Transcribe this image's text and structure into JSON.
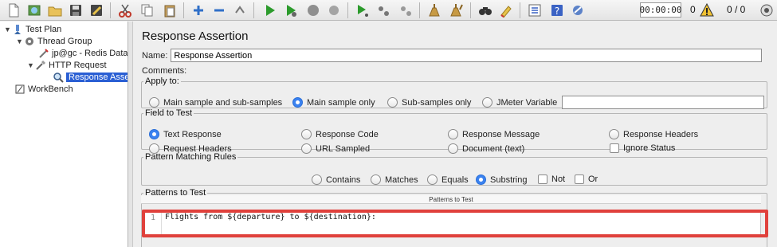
{
  "toolbar": {
    "buttons": [
      {
        "name": "new-icon"
      },
      {
        "name": "templates-icon"
      },
      {
        "name": "open-icon"
      },
      {
        "name": "save-icon"
      },
      {
        "name": "save-as-icon"
      },
      {
        "name": "cut-icon"
      },
      {
        "name": "copy-icon"
      },
      {
        "name": "paste-icon"
      },
      {
        "name": "expand-icon"
      },
      {
        "name": "collapse-icon"
      },
      {
        "name": "toggle-icon"
      },
      {
        "name": "start-icon"
      },
      {
        "name": "start-no-pause-icon"
      },
      {
        "name": "stop-icon"
      },
      {
        "name": "shutdown-icon"
      },
      {
        "name": "remote-start-icon"
      },
      {
        "name": "remote-stop-icon"
      },
      {
        "name": "remote-shutdown-icon"
      },
      {
        "name": "clear-icon"
      },
      {
        "name": "clear-all-icon"
      },
      {
        "name": "search-icon"
      },
      {
        "name": "reset-search-icon"
      },
      {
        "name": "function-helper-icon"
      },
      {
        "name": "help-icon"
      },
      {
        "name": "options-icon"
      }
    ],
    "timer": "00:00:00",
    "warning_count": "0",
    "threads": "0 / 0"
  },
  "tree": {
    "items": [
      {
        "label": "Test Plan"
      },
      {
        "label": "Thread Group"
      },
      {
        "label": "jp@gc - Redis Data"
      },
      {
        "label": "HTTP Request"
      },
      {
        "label": "Response Asser"
      },
      {
        "label": "WorkBench"
      }
    ]
  },
  "panel": {
    "title": "Response Assertion",
    "name_label": "Name:",
    "name_value": "Response Assertion",
    "comments_label": "Comments:"
  },
  "apply_to": {
    "legend": "Apply to:",
    "options": [
      {
        "label": "Main sample and sub-samples",
        "selected": false
      },
      {
        "label": "Main sample only",
        "selected": true
      },
      {
        "label": "Sub-samples only",
        "selected": false
      },
      {
        "label": "JMeter Variable",
        "selected": false
      }
    ],
    "variable_value": ""
  },
  "field_to_test": {
    "legend": "Field to Test",
    "options": [
      {
        "label": "Text Response",
        "selected": true
      },
      {
        "label": "Response Code",
        "selected": false
      },
      {
        "label": "Response Message",
        "selected": false
      },
      {
        "label": "Response Headers",
        "selected": false
      },
      {
        "label": "Request Headers",
        "selected": false
      },
      {
        "label": "URL Sampled",
        "selected": false
      },
      {
        "label": "Document (text)",
        "selected": false
      }
    ],
    "ignore_status_label": "Ignore Status",
    "ignore_status_checked": false
  },
  "pattern_rules": {
    "legend": "Pattern Matching Rules",
    "options": [
      {
        "label": "Contains",
        "selected": false
      },
      {
        "label": "Matches",
        "selected": false
      },
      {
        "label": "Equals",
        "selected": false
      },
      {
        "label": "Substring",
        "selected": true
      }
    ],
    "not_label": "Not",
    "or_label": "Or"
  },
  "patterns": {
    "legend": "Patterns to Test",
    "column_header": "Patterns to Test",
    "line_number": "1",
    "line_text": "Flights from ${departure} to ${destination}:"
  },
  "colors": {
    "selection": "#2a5fd4",
    "radio_selected": "#3b82f0",
    "highlight_box": "#e0413c"
  }
}
